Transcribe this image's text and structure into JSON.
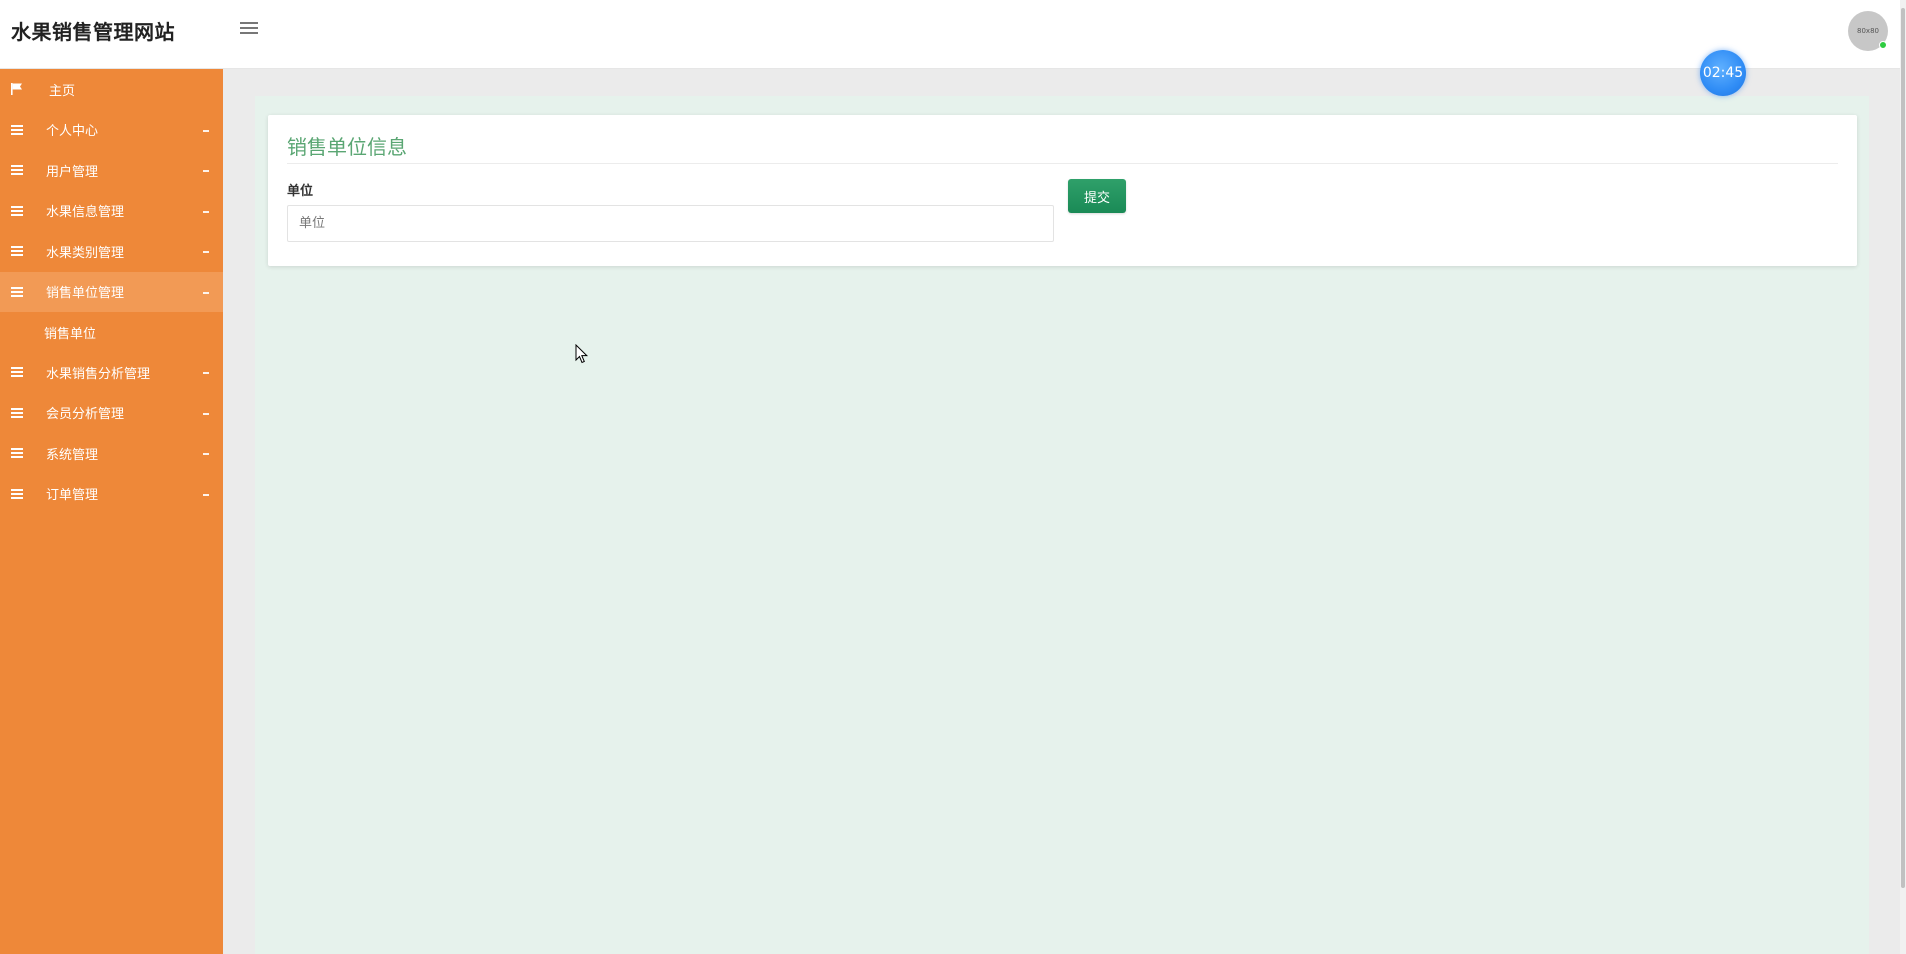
{
  "header": {
    "brand": "水果销售管理网站",
    "avatar_text": "80x80"
  },
  "timer": {
    "time": "02:45"
  },
  "sidebar": {
    "accent_color": "#ee8839",
    "items": [
      {
        "label": "主页",
        "icon": "flag-icon"
      },
      {
        "label": "个人中心",
        "icon": "list-icon"
      },
      {
        "label": "用户管理",
        "icon": "list-icon"
      },
      {
        "label": "水果信息管理",
        "icon": "list-icon"
      },
      {
        "label": "水果类别管理",
        "icon": "list-icon"
      },
      {
        "label": "销售单位管理",
        "icon": "list-icon",
        "expanded": true,
        "children": [
          {
            "label": "销售单位"
          }
        ]
      },
      {
        "label": "水果销售分析管理",
        "icon": "list-icon"
      },
      {
        "label": "会员分析管理",
        "icon": "list-icon"
      },
      {
        "label": "系统管理",
        "icon": "list-icon"
      },
      {
        "label": "订单管理",
        "icon": "list-icon"
      }
    ]
  },
  "form": {
    "title": "销售单位信息",
    "field_label": "单位",
    "field_placeholder": "单位",
    "field_value": "",
    "submit_label": "提交",
    "title_color": "#5aa673",
    "button_color": "#1a8a56"
  }
}
